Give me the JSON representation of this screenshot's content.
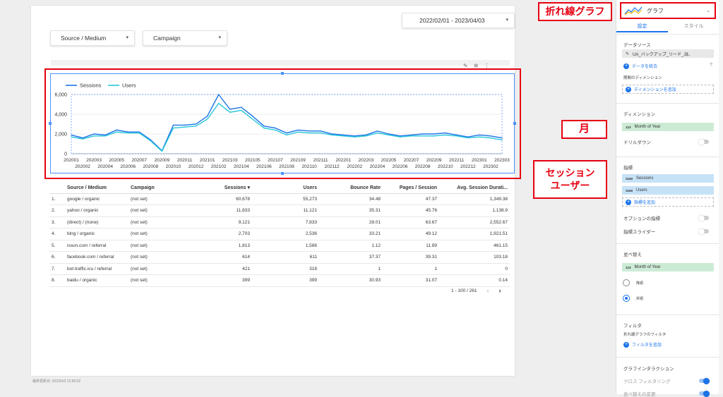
{
  "date_range": "2022/02/01 - 2023/04/03",
  "filters": {
    "source_medium": "Source / Medium",
    "campaign": "Campaign"
  },
  "last_updated": "最終更新日: 2023/4/3 12:56:02",
  "chart_data": {
    "type": "line",
    "title": "",
    "xlabel": "",
    "ylabel": "",
    "ylim": [
      0,
      6000
    ],
    "yticks": [
      "6,000",
      "4,000",
      "2,000",
      "0"
    ],
    "legend": "top-left",
    "categories": [
      "202001",
      "202002",
      "202003",
      "202004",
      "202005",
      "202006",
      "202007",
      "202008",
      "202009",
      "202010",
      "202011",
      "202012",
      "202101",
      "202102",
      "202103",
      "202104",
      "202105",
      "202106",
      "202107",
      "202108",
      "202109",
      "202110",
      "202111",
      "202112",
      "202201",
      "202202",
      "202203",
      "202204",
      "202205",
      "202206",
      "202207",
      "202208",
      "202209",
      "202210",
      "202211",
      "202212",
      "202301",
      "202302",
      "202303"
    ],
    "series": [
      {
        "name": "Sessions",
        "color": "#1a73e8",
        "values": [
          1900,
          1600,
          2000,
          1900,
          2400,
          2200,
          2200,
          1400,
          300,
          2900,
          2900,
          3000,
          3800,
          6000,
          4500,
          4700,
          3800,
          2800,
          2600,
          2100,
          2400,
          2300,
          2300,
          2000,
          1900,
          1800,
          1900,
          2300,
          2000,
          1800,
          1900,
          2000,
          2000,
          2100,
          1900,
          1700,
          1900,
          1800,
          1600
        ]
      },
      {
        "name": "Users",
        "color": "#26c6da",
        "values": [
          1700,
          1500,
          1800,
          1800,
          2200,
          2100,
          2100,
          1300,
          250,
          2600,
          2700,
          2800,
          3500,
          5100,
          4200,
          4400,
          3500,
          2600,
          2400,
          1900,
          2200,
          2100,
          2100,
          1900,
          1800,
          1700,
          1800,
          2100,
          1900,
          1700,
          1800,
          1800,
          1800,
          1900,
          1800,
          1600,
          1700,
          1600,
          1400
        ]
      }
    ]
  },
  "table": {
    "headers": [
      "Source / Medium",
      "Campaign",
      "Sessions ▾",
      "Users",
      "Bounce Rate",
      "Pages / Session",
      "Avg. Session Durati..."
    ],
    "rows": [
      [
        "1.",
        "google / organic",
        "(not set)",
        "60,678",
        "55,273",
        "34.48",
        "47.37",
        "1,349.38"
      ],
      [
        "2.",
        "yahoo / organic",
        "(not set)",
        "11,833",
        "11,121",
        "35.31",
        "45.76",
        "1,138.9"
      ],
      [
        "3.",
        "(direct) / (none)",
        "(not set)",
        "9,121",
        "7,833",
        "28.01",
        "63.67",
        "2,552.67"
      ],
      [
        "4.",
        "bing / organic",
        "(not set)",
        "2,703",
        "2,536",
        "33.21",
        "49.12",
        "1,921.51"
      ],
      [
        "5.",
        "issun.com / referral",
        "(not set)",
        "1,813",
        "1,586",
        "1.12",
        "11.89",
        "461.15"
      ],
      [
        "6.",
        "facebook.com / referral",
        "(not set)",
        "614",
        "611",
        "37.37",
        "39.31",
        "103.18"
      ],
      [
        "7.",
        "bot-traffic.icu / referral",
        "(not set)",
        "421",
        "318",
        "1",
        "1",
        "0"
      ],
      [
        "8.",
        "baidu / organic",
        "(not set)",
        "399",
        "399",
        "30.93",
        "31.07",
        "0.14"
      ]
    ],
    "pagination": "1 - 100 / 261"
  },
  "callouts": {
    "chart_type": "折れ線グラフ",
    "month": "月",
    "session_user_1": "セッション",
    "session_user_2": "ユーザー"
  },
  "panel": {
    "chart_type_label": "グラフ",
    "tabs": [
      "設定",
      "スタイル"
    ],
    "data_source_title": "データソース",
    "data_source_name": "UA_バックアップ_リード_J$..",
    "blend_data": "データを統合",
    "date_dimension": "期間のディメンション",
    "add_dimension": "ディメンションを追加",
    "dimension_title": "ディメンション",
    "dimension_field": "Month of Year",
    "drilldown": "ドリルダウン",
    "metric_title": "指標",
    "metric_1": "Sessions",
    "metric_2": "Users",
    "add_metric": "指標を追加",
    "optional_metrics": "オプションの指標",
    "metric_slider": "指標スライダー",
    "sort_title": "並べ替え",
    "sort_field": "Month of Year",
    "sort_desc": "降順",
    "sort_asc": "昇順",
    "filter_title": "フィルタ",
    "filter_sub": "折れ線グラフのフィルタ",
    "add_filter": "フィルタを追加",
    "interaction_title": "グラフインタラクション",
    "cross_filter": "クロス フィルタリング",
    "sort_change": "並べ替えの変更",
    "type_badge": "123",
    "sum_badge": "SUM"
  }
}
